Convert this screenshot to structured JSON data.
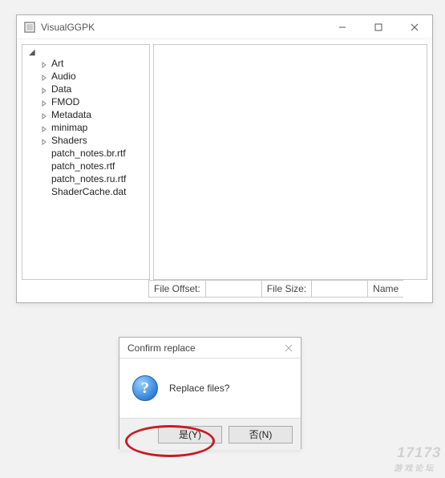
{
  "main": {
    "title": "VisualGGPK",
    "tree": {
      "folders": [
        "Art",
        "Audio",
        "Data",
        "FMOD",
        "Metadata",
        "minimap",
        "Shaders"
      ],
      "files": [
        "patch_notes.br.rtf",
        "patch_notes.rtf",
        "patch_notes.ru.rtf",
        "ShaderCache.dat"
      ]
    },
    "status": {
      "offset_label": "File Offset:",
      "offset_value": "",
      "size_label": "File Size:",
      "size_value": "",
      "name_label": "Name"
    }
  },
  "dialog": {
    "title": "Confirm replace",
    "message": "Replace files?",
    "yes": "是(Y)",
    "no": "否(N)"
  },
  "watermark": {
    "big": "17173",
    "small": "游戏论坛"
  }
}
